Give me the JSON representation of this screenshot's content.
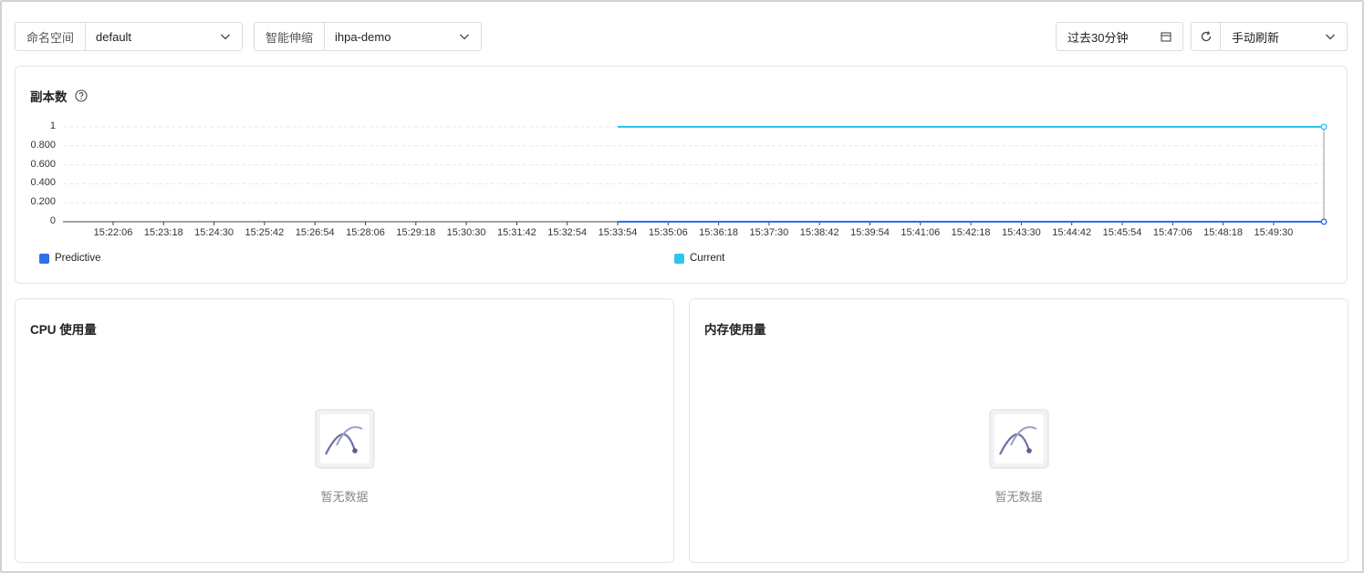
{
  "toolbar": {
    "namespace": {
      "label": "命名空间",
      "value": "default"
    },
    "autoscaler": {
      "label": "智能伸缩",
      "value": "ihpa-demo"
    },
    "time_range": "过去30分钟",
    "refresh_mode": "手动刷新"
  },
  "replica_card": {
    "title": "副本数",
    "legend": [
      {
        "name": "Predictive",
        "color": "#2f6fe8"
      },
      {
        "name": "Current",
        "color": "#2ec4f0"
      }
    ]
  },
  "chart_data": {
    "type": "line",
    "title": "副本数",
    "y_ticks": [
      "1",
      "0.800",
      "0.600",
      "0.400",
      "0.200",
      "0"
    ],
    "ylim": [
      0,
      1
    ],
    "x_ticks": [
      "15:22:06",
      "15:23:18",
      "15:24:30",
      "15:25:42",
      "15:26:54",
      "15:28:06",
      "15:29:18",
      "15:30:30",
      "15:31:42",
      "15:32:54",
      "15:33:54",
      "15:35:06",
      "15:36:18",
      "15:37:30",
      "15:38:42",
      "15:39:54",
      "15:41:06",
      "15:42:18",
      "15:43:30",
      "15:44:42",
      "15:45:54",
      "15:47:06",
      "15:48:18",
      "15:49:30"
    ],
    "grid": true,
    "legend_position": "bottom",
    "series": [
      {
        "name": "Predictive",
        "color": "#2f6fe8",
        "x_start": "15:33:54",
        "value": 0
      },
      {
        "name": "Current",
        "color": "#2ec4f0",
        "x_start": "15:33:54",
        "value": 1
      }
    ]
  },
  "cpu_card": {
    "title": "CPU 使用量",
    "empty_text": "暂无数据"
  },
  "mem_card": {
    "title": "内存使用量",
    "empty_text": "暂无数据"
  }
}
